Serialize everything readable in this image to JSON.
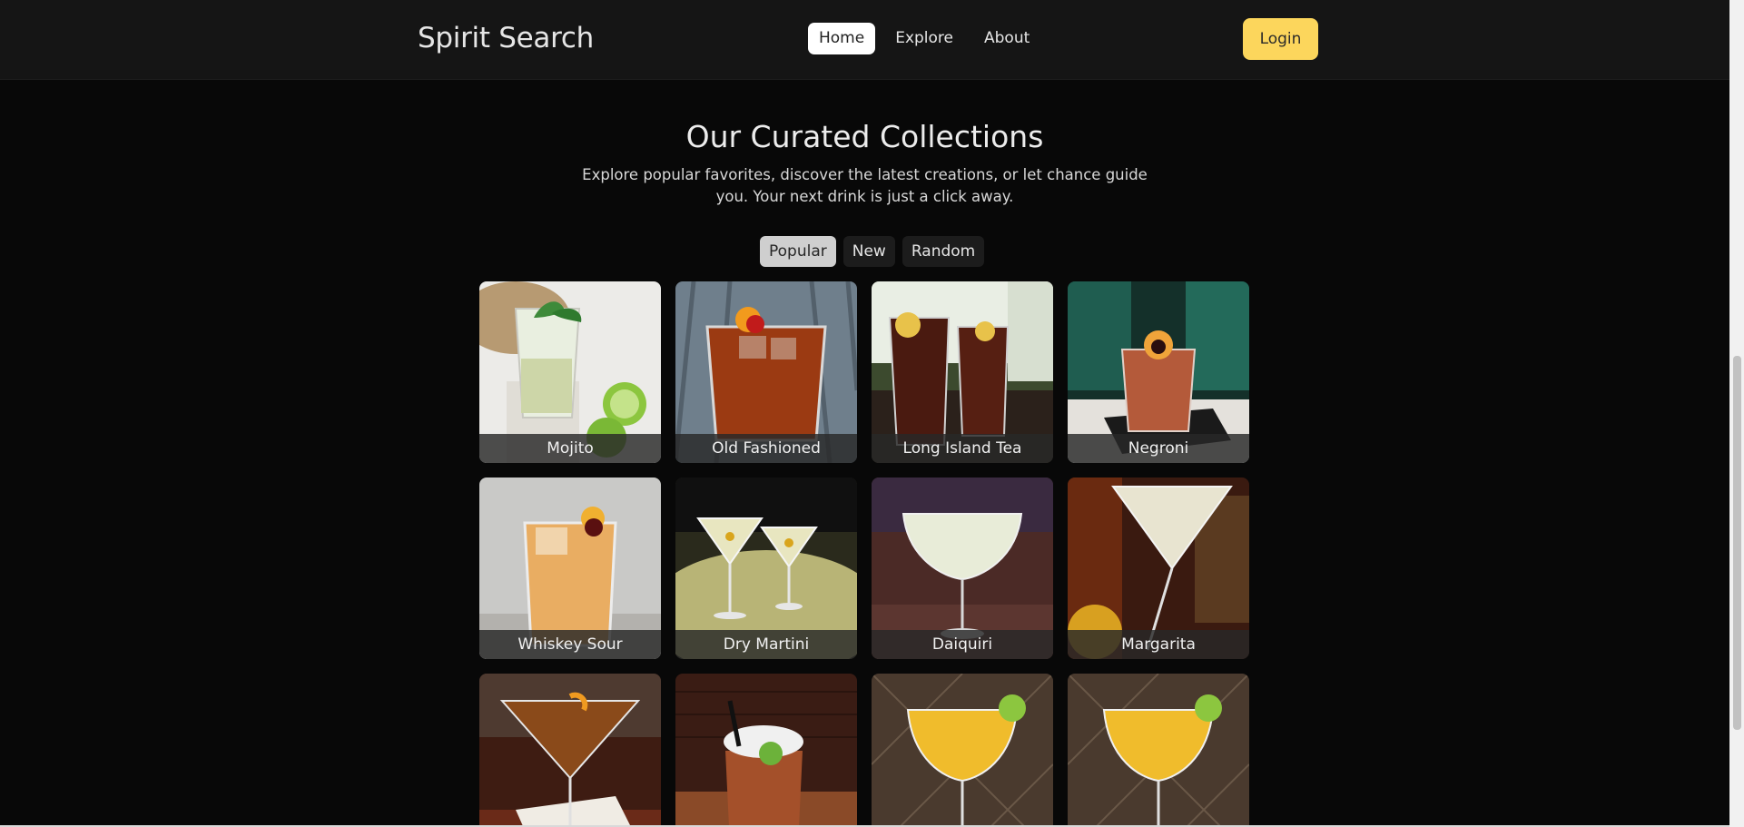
{
  "header": {
    "brand": "Spirit Search",
    "nav": [
      {
        "label": "Home",
        "active": true
      },
      {
        "label": "Explore",
        "active": false
      },
      {
        "label": "About",
        "active": false
      }
    ],
    "login_label": "Login",
    "accent_color": "#fcd65c"
  },
  "hero": {
    "title": "Our Curated Collections",
    "subtitle": "Explore popular favorites, discover the latest creations, or let chance guide you. Your next drink is just a click away."
  },
  "tabs": [
    {
      "label": "Popular",
      "active": true
    },
    {
      "label": "New",
      "active": false
    },
    {
      "label": "Random",
      "active": false
    }
  ],
  "drinks": [
    {
      "name": "Mojito",
      "icon": "highball-mint-icon"
    },
    {
      "name": "Old Fashioned",
      "icon": "rocks-glass-orange-icon"
    },
    {
      "name": "Long Island Tea",
      "icon": "tall-glasses-lemon-icon"
    },
    {
      "name": "Negroni",
      "icon": "rocks-glass-orange-icon"
    },
    {
      "name": "Whiskey Sour",
      "icon": "rocks-glass-cherry-icon"
    },
    {
      "name": "Dry Martini",
      "icon": "martini-glasses-icon"
    },
    {
      "name": "Daiquiri",
      "icon": "coupe-glass-icon"
    },
    {
      "name": "Margarita",
      "icon": "martini-glass-icon"
    },
    {
      "name": "",
      "icon": "martini-glass-orange-peel-icon"
    },
    {
      "name": "",
      "icon": "copper-mug-lime-icon"
    },
    {
      "name": "",
      "icon": "coupe-glass-lime-icon"
    },
    {
      "name": "",
      "icon": "coupe-glass-lime-icon"
    }
  ]
}
